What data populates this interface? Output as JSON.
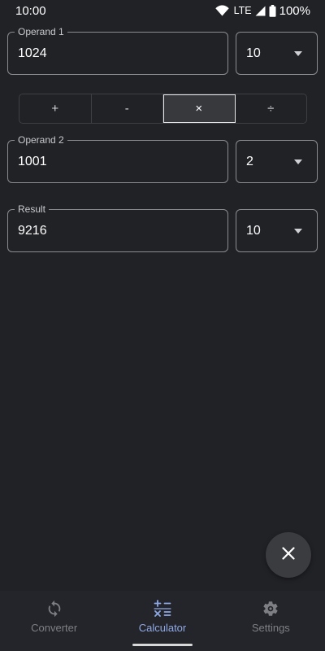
{
  "status_bar": {
    "time": "10:00",
    "network": "LTE",
    "battery": "100%"
  },
  "operand1": {
    "label": "Operand 1",
    "value": "1024",
    "base": "10"
  },
  "operations": {
    "items": [
      "+",
      "-",
      "×",
      "÷"
    ],
    "selected": "×"
  },
  "operand2": {
    "label": "Operand 2",
    "value": "1001",
    "base": "2"
  },
  "result": {
    "label": "Result",
    "value": "9216",
    "base": "10"
  },
  "fab": {
    "icon": "close-icon"
  },
  "bottom_nav": {
    "items": [
      {
        "label": "Converter",
        "icon": "sync-icon"
      },
      {
        "label": "Calculator",
        "icon": "calculator-icon",
        "active": true
      },
      {
        "label": "Settings",
        "icon": "gear-icon"
      }
    ]
  },
  "colors": {
    "background": "#212226",
    "accent": "#8fa9e6",
    "outline": "#8a8c91"
  }
}
